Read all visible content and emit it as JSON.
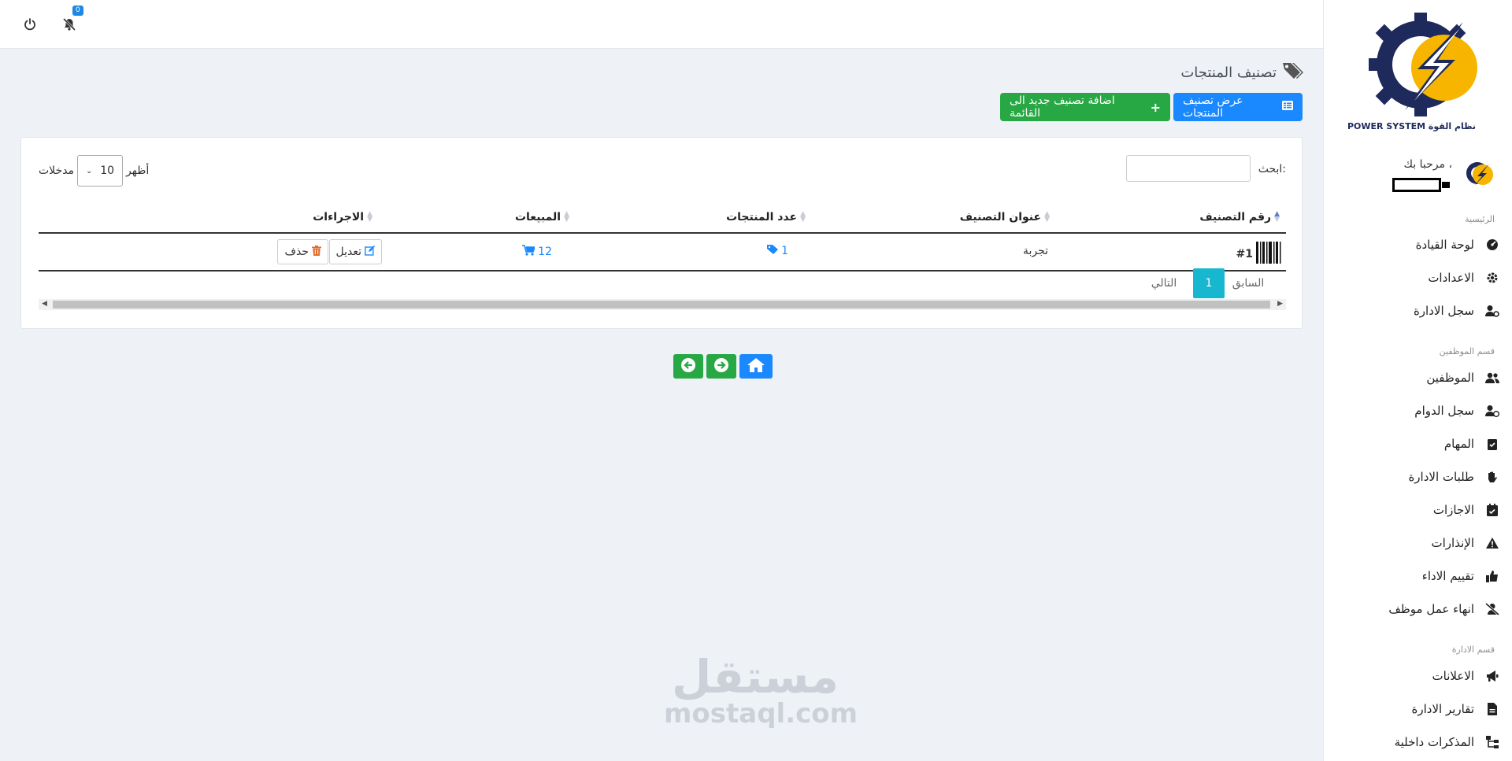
{
  "topbar": {
    "notification_count": "0"
  },
  "sidebar": {
    "logo_text": "POWER SYSTEM نظام القوة",
    "welcome": "مرحبا بك ،",
    "sections": {
      "main": "الرئيسية",
      "employees": "قسم الموظفين",
      "management": "قسم الادارة"
    },
    "items": [
      {
        "label": "لوحة القيادة",
        "icon": "dashboard-icon"
      },
      {
        "label": "الاعدادات",
        "icon": "gear-icon"
      },
      {
        "label": "سجل الادارة",
        "icon": "user-cog-icon"
      },
      {
        "label": "الموظفين",
        "icon": "users-icon"
      },
      {
        "label": "سجل الدوام",
        "icon": "user-clock-icon"
      },
      {
        "label": "المهام",
        "icon": "clipboard-check-icon"
      },
      {
        "label": "طلبات الادارة",
        "icon": "hand-icon"
      },
      {
        "label": "الاجازات",
        "icon": "calendar-check-icon"
      },
      {
        "label": "الإنذارات",
        "icon": "warning-icon"
      },
      {
        "label": "تقييم الاداء",
        "icon": "thumbs-up-icon"
      },
      {
        "label": "انهاء عمل موظف",
        "icon": "user-slash-icon"
      },
      {
        "label": "الاعلانات",
        "icon": "megaphone-icon"
      },
      {
        "label": "تقارير الادارة",
        "icon": "file-icon"
      },
      {
        "label": "المذكرات داخلية",
        "icon": "sitemap-icon"
      }
    ]
  },
  "page": {
    "title": "تصنيف المنتجات",
    "view_button": "عرض تصنيف المنتجات",
    "add_button": "اضافة تصنيف جديد الى القائمة"
  },
  "table": {
    "search_label": "ابحث:",
    "length_show": "أظهر",
    "length_value": "10",
    "length_entries": "مدخلات",
    "columns": [
      "رقم التصنيف",
      "عنوان التصنيف",
      "عدد المنتجات",
      "المبيعات",
      "الاجراءات"
    ],
    "rows": [
      {
        "id": "#1",
        "title": "تجربة",
        "products": "1",
        "sales": "12",
        "edit": "تعديل",
        "delete": "حذف"
      }
    ],
    "pagination": {
      "prev": "السابق",
      "page": "1",
      "next": "التالي"
    }
  },
  "watermark": {
    "arabic": "مستقل",
    "latin": "mostaql.com"
  },
  "colors": {
    "primary": "#1a88ff",
    "success": "#27a844",
    "info": "#17b7cf",
    "logo_navy": "#1f2a5c",
    "logo_gold": "#f7b500"
  }
}
